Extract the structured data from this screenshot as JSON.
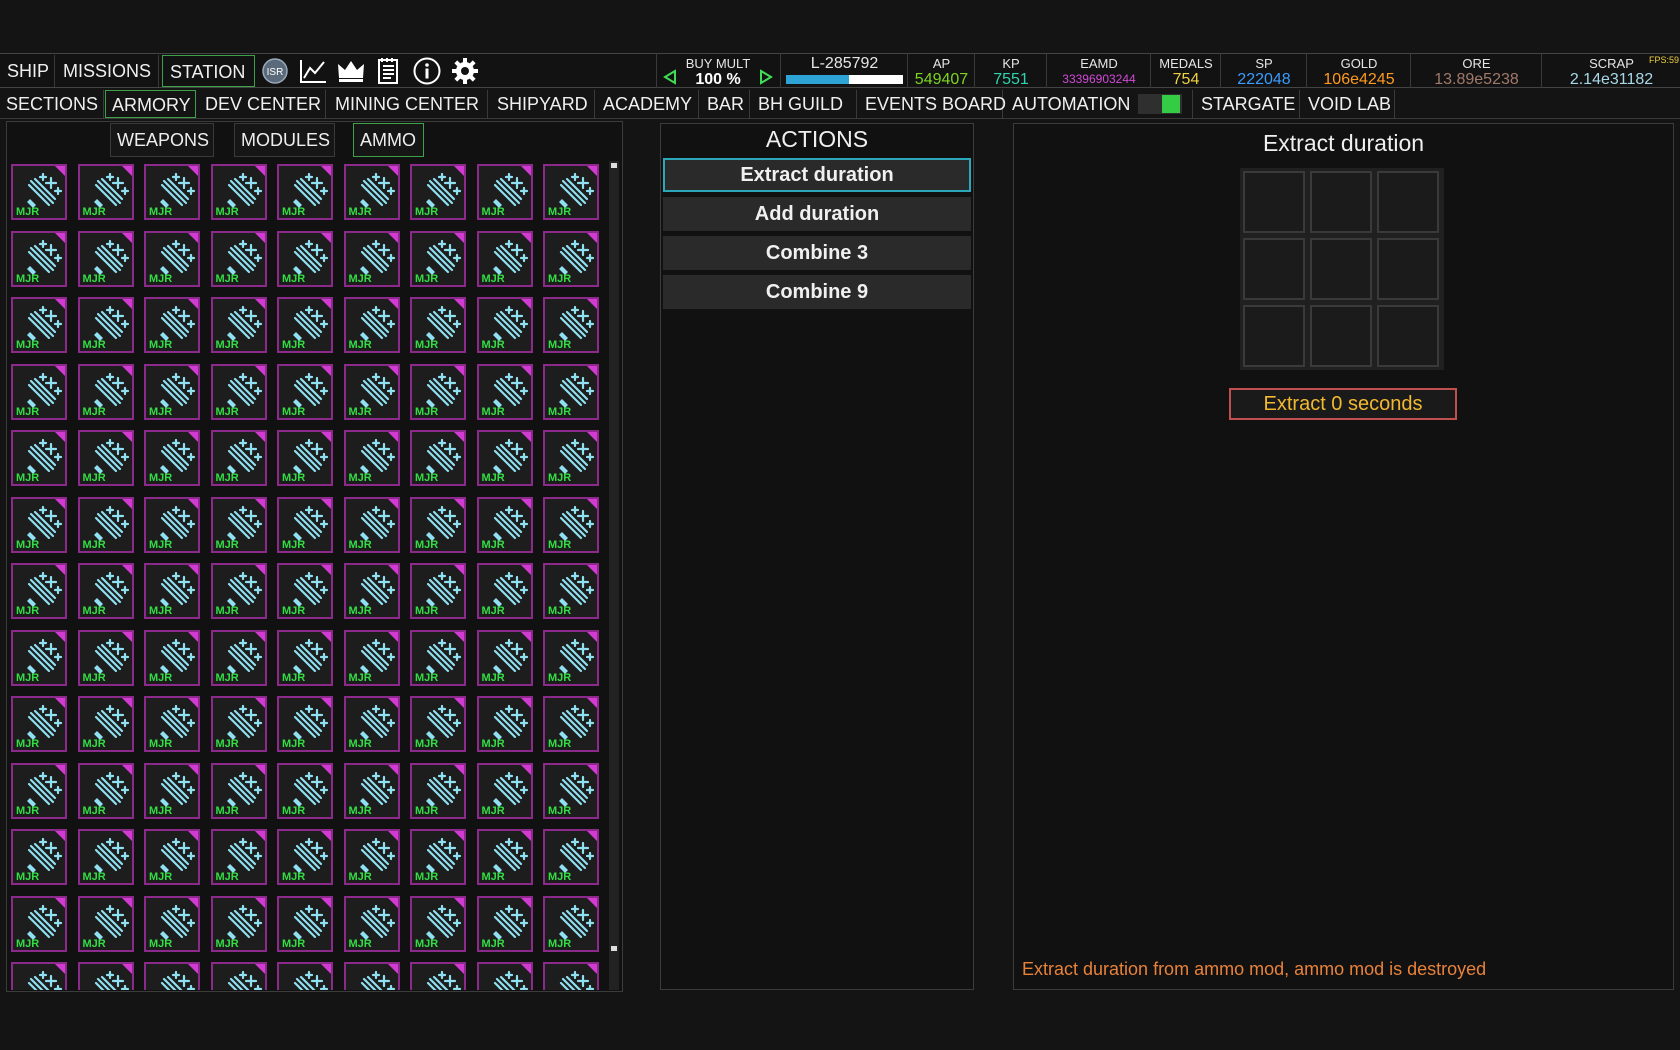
{
  "topbar": {
    "nav": [
      "SHIP",
      "MISSIONS",
      "STATION"
    ],
    "active_nav": "STATION",
    "isr_label": "ISR",
    "icons": [
      "isr-icon",
      "chart-icon",
      "crown-icon",
      "notes-icon",
      "info-icon",
      "gear-icon"
    ],
    "buy_mult": {
      "label": "BUY MULT",
      "value": "100 %"
    },
    "level": {
      "text": "L-285792",
      "progress": 0.54
    },
    "stats": [
      {
        "label": "AP",
        "value": "549407",
        "color": "#7ed321"
      },
      {
        "label": "KP",
        "value": "7551",
        "color": "#2fd3b0"
      },
      {
        "label": "EAMD",
        "value": "33396903244",
        "color": "#d04ad8"
      },
      {
        "label": "MEDALS",
        "value": "754",
        "color": "#f0d040"
      },
      {
        "label": "SP",
        "value": "222048",
        "color": "#3a9cff"
      },
      {
        "label": "GOLD",
        "value": "106e4245",
        "color": "#ff9a1e"
      },
      {
        "label": "ORE",
        "value": "13.89e5238",
        "color": "#a07a6a"
      },
      {
        "label": "SCRAP",
        "value": "2.14e31182",
        "color": "#a8d8e8"
      }
    ],
    "fps": "FPS:59"
  },
  "sections": [
    "SECTIONS",
    "ARMORY",
    "DEV CENTER",
    "MINING CENTER",
    "SHIPYARD",
    "ACADEMY",
    "BAR",
    "BH GUILD",
    "EVENTS BOARD",
    "AUTOMATION",
    "STARGATE",
    "VOID LAB"
  ],
  "active_section": "ARMORY",
  "automation_on": true,
  "armory": {
    "tabs": [
      "WEAPONS",
      "MODULES",
      "AMMO"
    ],
    "active_tab": "AMMO",
    "item_badge": "MJR",
    "rarity_color": "#c23ac2"
  },
  "actions": {
    "title": "ACTIONS",
    "buttons": [
      "Extract duration",
      "Add duration",
      "Combine 3",
      "Combine 9"
    ],
    "selected": "Extract duration"
  },
  "detail": {
    "title": "Extract duration",
    "extract_button": "Extract 0 seconds",
    "description": "Extract duration from ammo mod, ammo mod is destroyed"
  }
}
